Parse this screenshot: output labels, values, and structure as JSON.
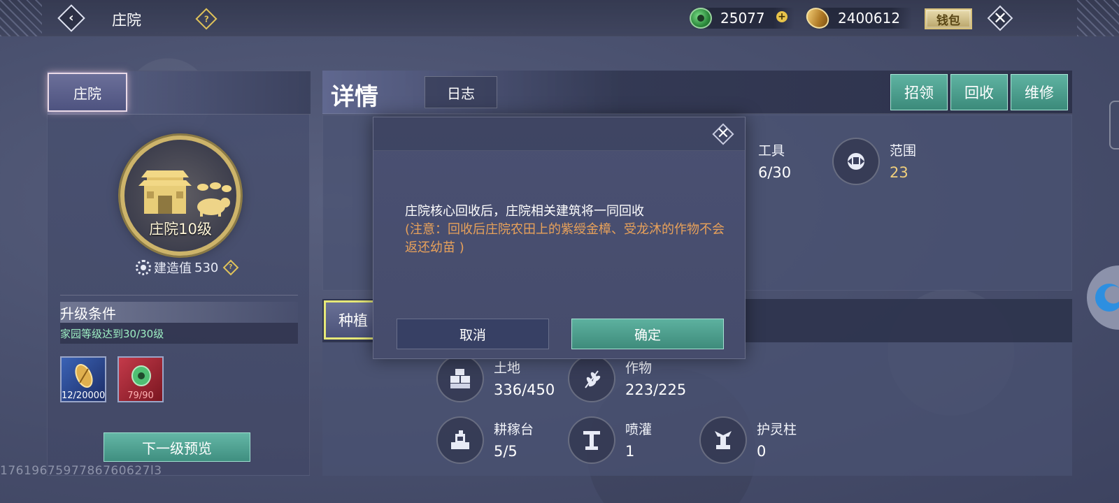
{
  "topbar": {
    "title": "庄院",
    "jade_amount": "25077",
    "coin_amount": "2400612",
    "wallet_label": "钱包"
  },
  "left": {
    "tab_label": "庄院",
    "emblem_label": "庄院10级",
    "build_label": "建造值",
    "build_value": "530",
    "upgrade_title": "升级条件",
    "upgrade_condition": "家园等级达到30/30级",
    "requirements": [
      {
        "icon": "coin-icon",
        "count": "12/20000"
      },
      {
        "icon": "jade-icon",
        "count": "79/90"
      }
    ],
    "preview_button": "下一级预览",
    "uid": "1761967597786760627l3"
  },
  "right": {
    "detail_title": "详情",
    "log_tab": "日志",
    "actions": {
      "recruit": "招领",
      "recycle": "回收",
      "repair": "维修"
    },
    "info_stats": [
      {
        "icon": "tool-icon",
        "label": "工具",
        "value": "6/30"
      },
      {
        "icon": "range-icon",
        "label": "范围",
        "value": "23"
      }
    ],
    "farm_tab": "种植",
    "farm_stats": [
      {
        "icon": "land-icon",
        "label": "土地",
        "value": "336/450"
      },
      {
        "icon": "crop-icon",
        "label": "作物",
        "value": "223/225"
      },
      {
        "icon": "farming-platform-icon",
        "label": "耕稼台",
        "value": "5/5"
      },
      {
        "icon": "sprinkler-icon",
        "label": "喷灌",
        "value": "1"
      },
      {
        "icon": "guardian-pillar-icon",
        "label": "护灵柱",
        "value": "0"
      }
    ]
  },
  "modal": {
    "message": "庄院核心回收后，庄院相关建筑将一同回收",
    "note": "(注意：回收后庄院农田上的紫绶金樟、受龙沐的作物不会返还幼苗 )",
    "cancel_label": "取消",
    "confirm_label": "确定"
  },
  "colors": {
    "accent_teal": "#4fa090",
    "gold": "#f0cf7c",
    "note_orange": "#e8a15a",
    "condition_green": "#9ef0c4"
  }
}
